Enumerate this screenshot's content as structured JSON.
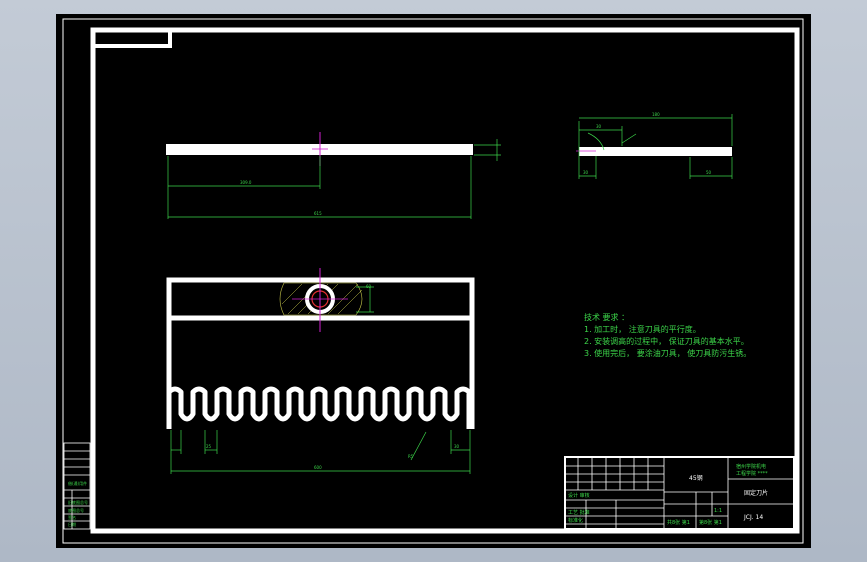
{
  "drawing": {
    "dimensions": {
      "top_half_length": "309.0",
      "top_total_length": "615",
      "front_total_length": "600",
      "side_length": "180",
      "side_small": "30",
      "side_right": "50",
      "side_left": "30",
      "slot_width": "25",
      "slot_gap": "30",
      "slot_end": "30",
      "angle": "R5",
      "depth": "60"
    },
    "tech_requirements": {
      "title": "技术 要求 ：",
      "items": [
        "1. 加工时， 注意刀具的平行度。",
        "2. 安装调高的过程中， 保证刀具的基本水平。",
        "3. 使用完后， 要涂油刀具， 使刀具防污生锈。"
      ]
    },
    "title_block": {
      "material": "45钢",
      "school_line1": "宿州学院机电",
      "school_line2": "工程学院 ****",
      "part_name": "固定刀片",
      "drawing_number": "JCJ. 14",
      "scale": "1:1",
      "sheet_left": "共8张 第1",
      "sheet_right": "第8张 第1",
      "designer": "设计 审核",
      "process": "工艺 批准",
      "standard": "标准化"
    },
    "side_table": {
      "label1": "借(通)用件",
      "label2": "旧底图总号",
      "label3": "底图总号",
      "label4": "签名",
      "label5": "日期"
    }
  }
}
